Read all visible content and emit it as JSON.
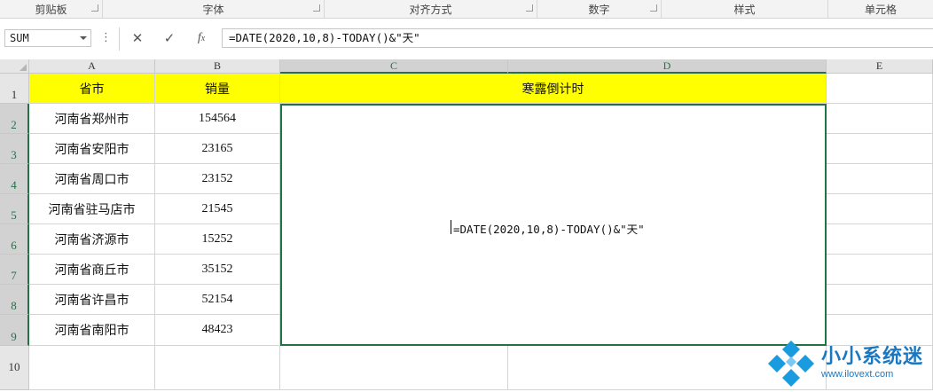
{
  "ribbon": {
    "groups": [
      "剪贴板",
      "字体",
      "对齐方式",
      "数字",
      "样式",
      "单元格"
    ]
  },
  "formula_bar": {
    "name_box": "SUM",
    "formula": "=DATE(2020,10,8)-TODAY()&\"天\"",
    "icons": [
      "cancel-icon",
      "enter-check-icon",
      "function-icon"
    ]
  },
  "columns": [
    "A",
    "B",
    "C",
    "D",
    "E"
  ],
  "rows": [
    "1",
    "2",
    "3",
    "4",
    "5",
    "6",
    "7",
    "8",
    "9",
    "10"
  ],
  "sheet": {
    "headers": [
      "省市",
      "销量",
      "寒露倒计时"
    ],
    "data": [
      {
        "city": "河南省郑州市",
        "sales": "154564"
      },
      {
        "city": "河南省安阳市",
        "sales": "23165"
      },
      {
        "city": "河南省周口市",
        "sales": "23152"
      },
      {
        "city": "河南省驻马店市",
        "sales": "21545"
      },
      {
        "city": "河南省济源市",
        "sales": "15252"
      },
      {
        "city": "河南省商丘市",
        "sales": "35152"
      },
      {
        "city": "河南省许昌市",
        "sales": "52154"
      },
      {
        "city": "河南省南阳市",
        "sales": "48423"
      }
    ],
    "editing_formula": "=DATE(2020,10,8)-TODAY()&\"天\"",
    "header_fill": "#ffff00",
    "selection_color": "#217346"
  },
  "watermark": {
    "name": "小小系统迷",
    "url": "www.ilovext.com"
  }
}
